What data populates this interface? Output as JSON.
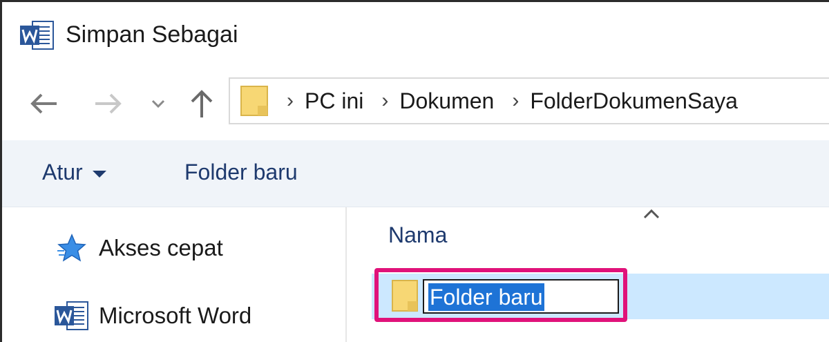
{
  "window": {
    "title": "Simpan Sebagai",
    "app_icon": "word-icon"
  },
  "navigation": {
    "back_icon": "arrow-left-icon",
    "forward_icon": "arrow-right-icon",
    "recent_icon": "chevron-down-icon",
    "up_icon": "arrow-up-icon",
    "breadcrumbs": [
      "PC ini",
      "Dokumen",
      "FolderDokumenSaya"
    ]
  },
  "toolbar": {
    "organize_label": "Atur",
    "new_folder_label": "Folder baru"
  },
  "nav_pane": {
    "items": [
      {
        "label": "Akses cepat",
        "icon": "star-icon"
      },
      {
        "label": "Microsoft Word",
        "icon": "word-icon"
      }
    ]
  },
  "file_list": {
    "column_header": "Nama",
    "sort_indicator": "sort-ascending-icon",
    "rows": [
      {
        "name": "Folder baru",
        "icon": "folder-icon",
        "state": "renaming"
      }
    ]
  },
  "colors": {
    "highlight_border": "#e0127a",
    "selection_row": "#cce8ff",
    "text_selection": "#1e73d6",
    "command_bar": "#f0f4f9",
    "link_text": "#1e3a6e"
  }
}
